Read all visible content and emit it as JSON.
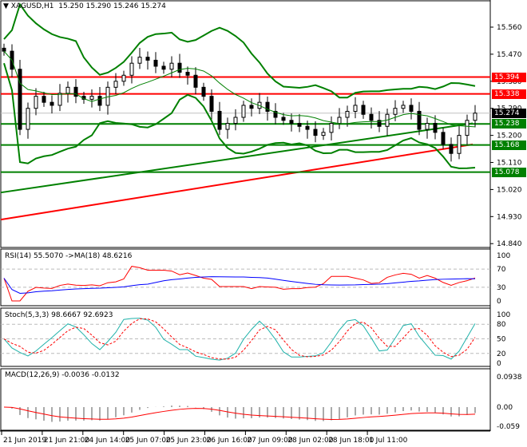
{
  "header": {
    "symbol": "XAGUSD,H1",
    "ohlc": "15.250 15.290 15.246 15.274"
  },
  "indicators": {
    "rsi": "RSI(14) 55.5070  ->MA(18) 48.6216",
    "stoch": "Stoch(5,3,3) 98.6667 92.6923",
    "macd": "MACD(12,26,9) -0.0036 -0.0132"
  },
  "colors": {
    "red": "#ff0000",
    "green": "#008000",
    "black": "#000000",
    "blue": "#0000ff",
    "teal": "#20b2aa"
  },
  "chart_data": {
    "type": "candlestick",
    "price_axis": {
      "range": [
        14.8,
        15.6
      ],
      "ticks": [
        "15.560",
        "15.470",
        "15.380",
        "15.290",
        "15.200",
        "15.110",
        "15.020",
        "14.930",
        "14.840"
      ]
    },
    "time_ticks": [
      "21 Jun 2019",
      "21 Jun 21:00",
      "24 Jun 14:00",
      "25 Jun 07:00",
      "25 Jun 23:00",
      "26 Jun 16:00",
      "27 Jun 09:00",
      "28 Jun 02:00",
      "28 Jun 18:00",
      "1 Jul 11:00"
    ],
    "closes": [
      15.48,
      15.42,
      15.22,
      15.29,
      15.33,
      15.31,
      15.3,
      15.34,
      15.36,
      15.33,
      15.32,
      15.33,
      15.3,
      15.36,
      15.38,
      15.4,
      15.44,
      15.46,
      15.45,
      15.43,
      15.42,
      15.44,
      15.41,
      15.4,
      15.36,
      15.33,
      15.28,
      15.22,
      15.24,
      15.26,
      15.3,
      15.29,
      15.31,
      15.28,
      15.26,
      15.25,
      15.24,
      15.23,
      15.22,
      15.2,
      15.21,
      15.24,
      15.26,
      15.28,
      15.3,
      15.27,
      15.25,
      15.23,
      15.27,
      15.29,
      15.3,
      15.28,
      15.22,
      15.24,
      15.21,
      15.17,
      15.14,
      15.2,
      15.25,
      15.274
    ],
    "levels": [
      {
        "value": "15.394",
        "color": "red"
      },
      {
        "value": "15.338",
        "color": "red"
      },
      {
        "value": "15.238",
        "color": "green"
      },
      {
        "value": "15.168",
        "color": "green"
      },
      {
        "value": "15.078",
        "color": "green"
      }
    ],
    "current_price": "15.274",
    "ma_slow": {
      "start": 14.92,
      "end": 15.17,
      "color": "red"
    },
    "ma_mid": {
      "start": 15.01,
      "end": 15.24,
      "color": "green"
    },
    "rsi_axis": [
      "100",
      "70",
      "30",
      "0"
    ],
    "stoch_axis": [
      "100",
      "80",
      "50",
      "20",
      "0"
    ],
    "macd_axis": [
      "0.0938",
      "0.00",
      "-0.059"
    ]
  }
}
